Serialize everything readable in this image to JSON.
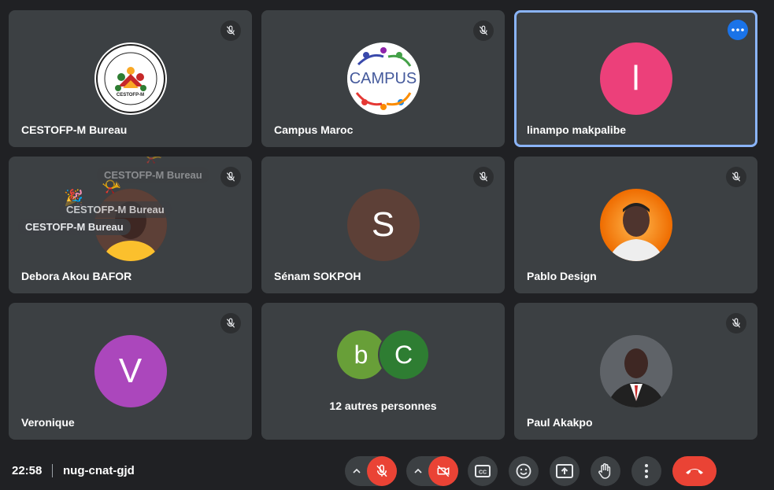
{
  "tiles": [
    {
      "name": "CESTOFP-M Bureau",
      "logo_text": "CESTOFP-M",
      "muted": true
    },
    {
      "name": "Campus Maroc",
      "logo_text": "CAMPUS",
      "muted": true
    },
    {
      "name": "linampo makpalibe",
      "initial": "l",
      "avatar_color": "#ec407a",
      "active": true
    },
    {
      "name": "Debora Akou BAFOR",
      "muted": true,
      "reaction_labels": [
        "CESTOFP-M Bureau",
        "CESTOFP-M Bureau",
        "CESTOFP-M Bureau"
      ]
    },
    {
      "name": "Sénam SOKPOH",
      "initial": "S",
      "avatar_color": "#5d4037",
      "muted": true
    },
    {
      "name": "Pablo Design",
      "muted": true
    },
    {
      "name": "Veronique",
      "initial": "V",
      "avatar_color": "#ab47bc",
      "muted": true
    },
    {
      "others_label": "12 autres personnes",
      "initials": [
        "b",
        "C"
      ],
      "avatar_colors": [
        "#689f38",
        "#2e7d32"
      ]
    },
    {
      "name": "Paul Akakpo",
      "muted": true
    }
  ],
  "bottom_bar": {
    "time": "22:58",
    "meeting_code": "nug-cnat-gjd",
    "controls": [
      "mic-off-icon",
      "camera-off-icon",
      "captions-icon",
      "emoji-icon",
      "present-icon",
      "raise-hand-icon",
      "more-options-icon",
      "hang-up-icon"
    ]
  },
  "colors": {
    "background": "#202124",
    "tile": "#3c4043",
    "active_border": "#8ab4f8",
    "danger": "#ea4335",
    "accent": "#1a73e8"
  }
}
